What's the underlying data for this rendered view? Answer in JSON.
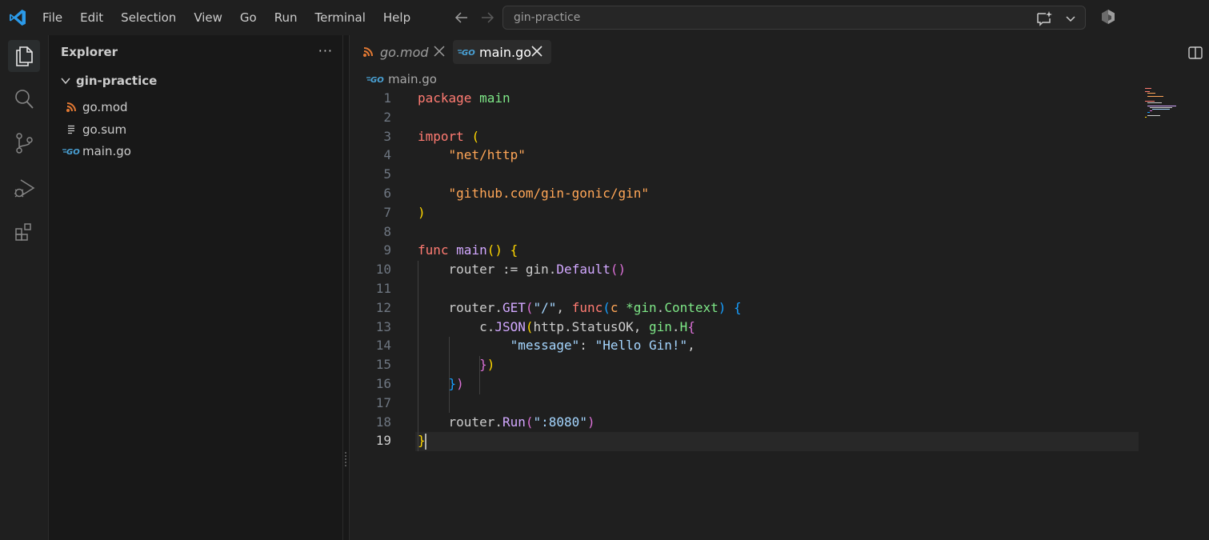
{
  "menu": {
    "items": [
      "File",
      "Edit",
      "Selection",
      "View",
      "Go",
      "Run",
      "Terminal",
      "Help"
    ]
  },
  "command_center": {
    "text": "gin-practice"
  },
  "icons": {
    "logo": "vscode-logo-icon",
    "explorer": "files-icon",
    "search": "search-icon",
    "scm": "source-control-icon",
    "debug": "run-debug-icon",
    "extensions": "extensions-icon"
  },
  "sidebar": {
    "title": "Explorer",
    "more": "···",
    "folder": "gin-practice",
    "files": [
      {
        "name": "go.mod",
        "icon": "rss-icon"
      },
      {
        "name": "go.sum",
        "icon": "lines-icon"
      },
      {
        "name": "main.go",
        "icon": "go-icon"
      }
    ]
  },
  "tabs": [
    {
      "label": "go.mod",
      "active": false
    },
    {
      "label": "main.go",
      "active": true
    }
  ],
  "breadcrumb": {
    "file": "main.go"
  },
  "editor": {
    "current_line": 19,
    "line_numbers": [
      "1",
      "2",
      "3",
      "4",
      "5",
      "6",
      "7",
      "8",
      "9",
      "10",
      "11",
      "12",
      "13",
      "14",
      "15",
      "16",
      "17",
      "18",
      "19"
    ],
    "code": [
      {
        "l1": "package",
        "l2": "main"
      },
      {},
      {
        "l1": "import",
        "l2": "("
      },
      {
        "l1": "\"net/http\""
      },
      {},
      {
        "l1": "\"github.com/gin-gonic/gin\""
      },
      {
        "l1": ")"
      },
      {},
      {
        "l1": "func",
        "l2": "main",
        "l3": "()",
        "l4": "{"
      },
      {
        "l1": "router",
        "l2": ":=",
        "l3": "gin",
        "l4": "Default",
        "l5": "()"
      },
      {},
      {
        "l1": "router",
        "l2": "GET",
        "l3": "\"/\"",
        "l4": "func",
        "l5": "c",
        "l6": "*gin",
        "l7": "Context",
        "l8": "{"
      },
      {
        "l1": "c",
        "l2": "JSON",
        "l3": "http.StatusOK,",
        "l4": "gin",
        "l5": "H",
        "l6": "{"
      },
      {
        "l1": "\"message\"",
        "l2": "\"Hello Gin!\""
      },
      {
        "l1": "})"
      },
      {
        "l1": "})"
      },
      {},
      {
        "l1": "router",
        "l2": "Run",
        "l3": "\":8080\""
      },
      {
        "l1": "}"
      }
    ]
  },
  "colors": {
    "background": "#1f1f1f",
    "sidebar": "#181818",
    "keyword": "#ff7b72",
    "string": "#ffa657",
    "function": "#d2a8ff",
    "type": "#7ee787"
  }
}
